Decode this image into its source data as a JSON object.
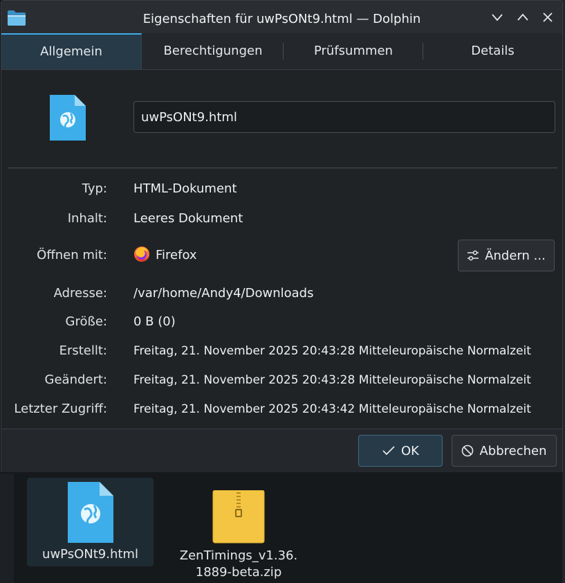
{
  "window": {
    "title": "Eigenschaften für uwPsONt9.html — Dolphin",
    "icon": "folder-icon"
  },
  "tabs": [
    {
      "label": "Allgemein",
      "active": true
    },
    {
      "label": "Berechtigungen",
      "active": false
    },
    {
      "label": "Prüfsummen",
      "active": false
    },
    {
      "label": "Details",
      "active": false
    }
  ],
  "file": {
    "name": "uwPsONt9.html",
    "icon": "html-file-icon"
  },
  "properties": {
    "type_label": "Typ:",
    "type_value": "HTML-Dokument",
    "content_label": "Inhalt:",
    "content_value": "Leeres Dokument",
    "open_label": "Öffnen mit:",
    "open_value": "Firefox",
    "address_label": "Adresse:",
    "address_value": "/var/home/Andy4/Downloads",
    "size_label": "Größe:",
    "size_value": "0 B (0)",
    "created_label": "Erstellt:",
    "created_value": "Freitag, 21. November 2025 20:43:28 Mitteleuropäische Normalzeit",
    "modified_label": "Geändert:",
    "modified_value": "Freitag, 21. November 2025 20:43:28 Mitteleuropäische Normalzeit",
    "accessed_label": "Letzter Zugriff:",
    "accessed_value": "Freitag, 21. November 2025 20:43:42 Mitteleuropäische Normalzeit"
  },
  "buttons": {
    "change": "Ändern ...",
    "ok": "OK",
    "cancel": "Abbrechen"
  },
  "desktop": {
    "items": [
      {
        "label": "uwPsONt9.html",
        "icon": "html-file-icon",
        "selected": true
      },
      {
        "label_line1": "ZenTimings_v1.36.",
        "label_line2": "1889-beta.zip",
        "icon": "zip-archive-icon",
        "selected": false
      }
    ]
  },
  "colors": {
    "accent": "#3daee9",
    "window_bg": "#202326",
    "file_icon_blue": "#3daee9",
    "zip_yellow": "#f4c542"
  }
}
